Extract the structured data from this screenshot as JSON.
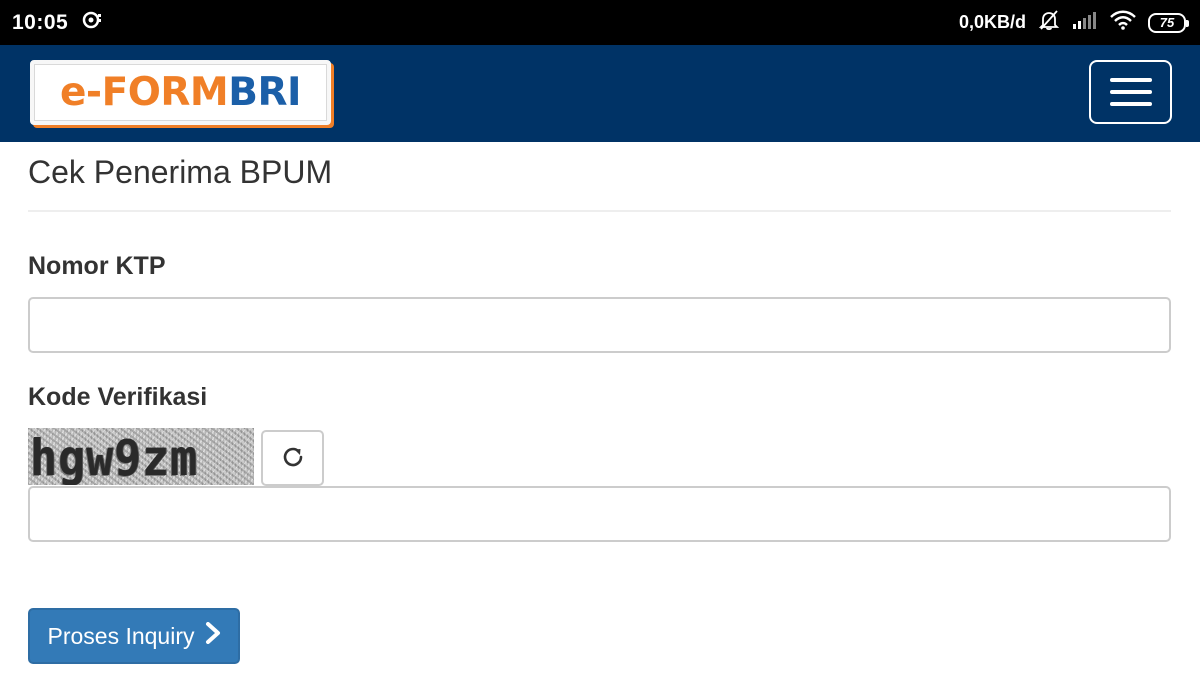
{
  "statusbar": {
    "time": "10:05",
    "net_speed": "0,0KB/d",
    "battery": "75"
  },
  "navbar": {
    "logo_prefix": "e-FORM",
    "logo_suffix": "BRI"
  },
  "form": {
    "title": "Cek Penerima BPUM",
    "ktp_label": "Nomor KTP",
    "ktp_value": "",
    "kode_label": "Kode Verifikasi",
    "captcha_text": "hgw9zm",
    "kode_value": "",
    "submit_label": "Proses Inquiry"
  },
  "icons": {
    "status_left": "sync-notification-icon",
    "status_right": [
      "bell-off-icon",
      "signal-icon",
      "wifi-icon",
      "battery-icon"
    ],
    "refresh": "refresh-icon",
    "submit": "chevron-right-icon",
    "menu": "hamburger-icon"
  },
  "colors": {
    "navbar": "#003366",
    "logo_orange": "#f07f27",
    "logo_blue": "#1b5fa8",
    "primary_button": "#337ab7"
  }
}
